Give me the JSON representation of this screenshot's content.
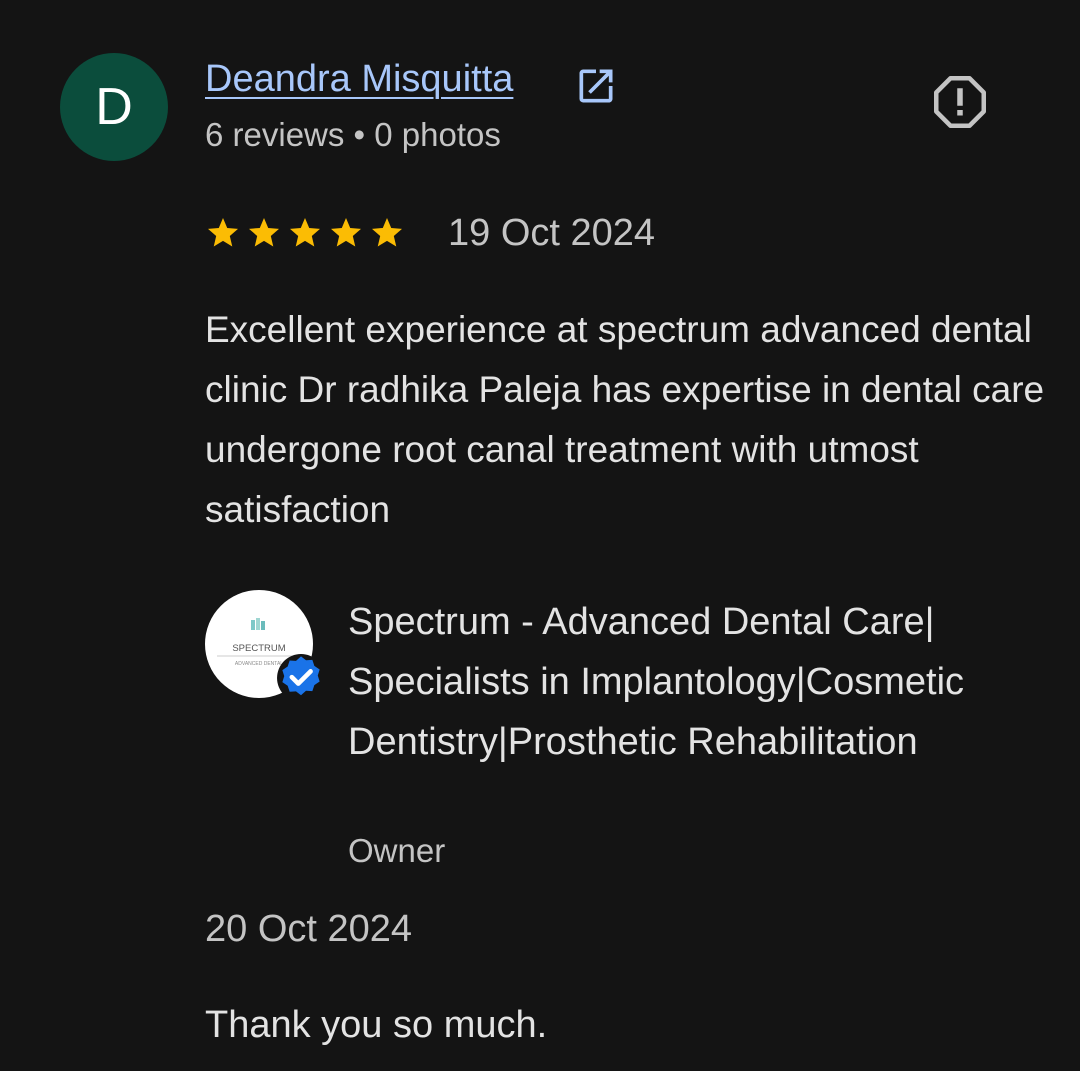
{
  "reviewer": {
    "initial": "D",
    "avatar_color": "#0b4d3c",
    "name": "Deandra Misquitta",
    "name_color": "#a8c7fa",
    "meta": "6 reviews • 0 photos",
    "link_icon": "open-in-new-icon",
    "report_icon": "report-icon"
  },
  "review": {
    "rating": 5,
    "max_rating": 5,
    "star_color": "#fbbc04",
    "date": "19 Oct 2024",
    "text": "Excellent experience at spectrum advanced dental clinic Dr radhika Paleja has expertise in dental care undergone root canal treatment with utmost satisfaction"
  },
  "owner_response": {
    "business_name": "Spectrum - Advanced Dental Care| Specialists in Implantology|Cosmetic Dentistry|Prosthetic Rehabilitation",
    "role": "Owner",
    "logo_text": "SPECTRUM",
    "logo_subtext": "ADVANCED DENTAL",
    "verified_icon": "verified-icon",
    "verified_color": "#1a73e8",
    "date": "20 Oct 2024",
    "text": "Thank you so much."
  }
}
